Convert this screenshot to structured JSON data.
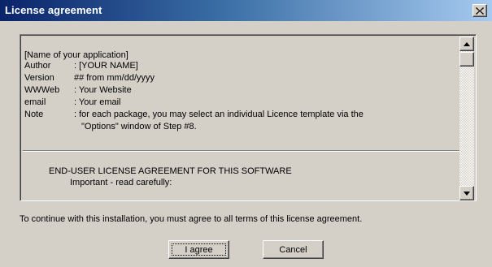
{
  "window": {
    "title": "License agreement",
    "close_glyph": "✕"
  },
  "license": {
    "app_name": "[Name of your application]",
    "meta": [
      {
        "key": "Author",
        "value": ": [YOUR NAME]"
      },
      {
        "key": "Version",
        "value": "  ## from mm/dd/yyyy"
      },
      {
        "key": "WWWeb",
        "value": ": Your Website"
      },
      {
        "key": "email",
        "value": ": Your email"
      },
      {
        "key": "Note",
        "value": ": for each package, you may select an individual Licence template via the"
      }
    ],
    "note_continuation": "\"Options\" window of Step #8.",
    "eula_heading": "END-USER LICENSE AGREEMENT FOR THIS SOFTWARE",
    "eula_subheading": "Important - read carefully:"
  },
  "instruction": "To continue with this installation, you must agree to all terms of this license agreement.",
  "buttons": {
    "agree_label": "I agree",
    "cancel_label": "Cancel"
  },
  "colors": {
    "titlebar_start": "#0a246a",
    "titlebar_end": "#a6caf0",
    "face": "#d4d0c8"
  }
}
